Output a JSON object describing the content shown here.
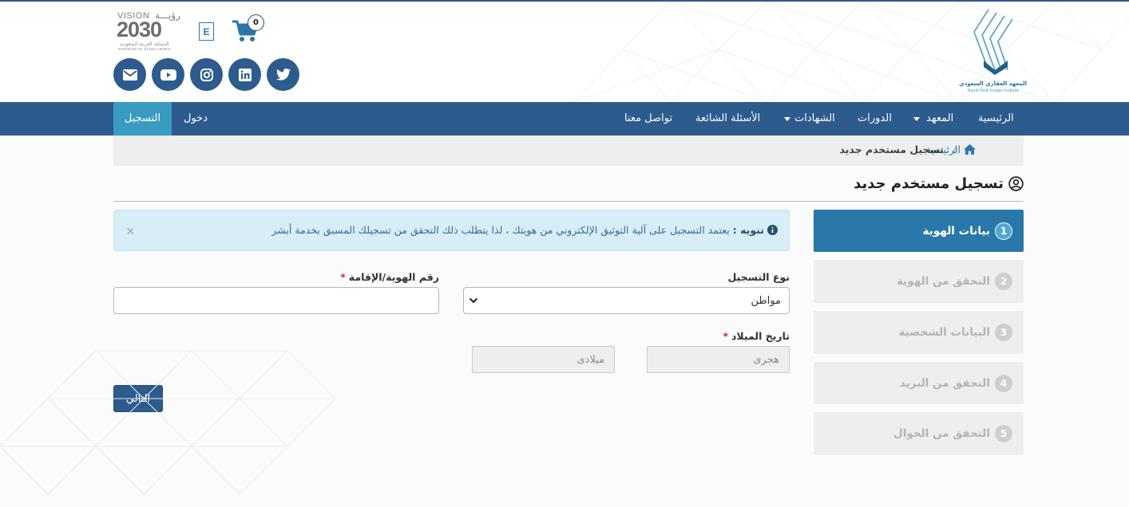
{
  "header": {
    "logo_text_ar": "المعهد العقاري السعودي",
    "logo_text_en": "Saudi Real Estate Institute",
    "vision_label": "VISION",
    "vision_label_ar": "رؤيـــة",
    "vision_year": "2030",
    "vision_sub_ar": "المملكة العربية السعودية",
    "vision_sub_en": "KINGDOM OF SAUDI ARABIA",
    "lang_toggle": "E",
    "cart_count": "0",
    "social_icons": [
      "envelope-icon",
      "youtube-icon",
      "instagram-icon",
      "linkedin-icon",
      "twitter-icon"
    ]
  },
  "nav": {
    "items": [
      {
        "label": "الرئيسية"
      },
      {
        "label": "المعهد",
        "dropdown": true
      },
      {
        "label": "الدورات"
      },
      {
        "label": "الشهادات",
        "dropdown": true
      },
      {
        "label": "الأسئلة الشائعة"
      },
      {
        "label": "تواصل معنا"
      }
    ],
    "login": "دخول",
    "register": "التسجيل"
  },
  "breadcrumb": {
    "home": "الرئيسية",
    "separator": "/",
    "current": "تسجيل مستخدم جديد"
  },
  "page": {
    "title": "تسجيل مستخدم جديد"
  },
  "steps": [
    {
      "number": "1",
      "label": "بيانات الهوية",
      "active": true
    },
    {
      "number": "2",
      "label": "التحقق من الهوية",
      "active": false
    },
    {
      "number": "3",
      "label": "البيانات الشخصية",
      "active": false
    },
    {
      "number": "4",
      "label": "التحقق من البريد",
      "active": false
    },
    {
      "number": "5",
      "label": "التحقق من الجوال",
      "active": false
    }
  ],
  "alert": {
    "title": "تنويه :",
    "message": "يعتمد التسجيل على آلية التوثيق الإلكتروني من هويتك ، لذا يتطلب ذلك التحقق من تسجيلك المسبق بخدمة أبشر",
    "close": "×"
  },
  "form": {
    "registration_type_label": "نوع التسجيل",
    "registration_type_value": "مواطن",
    "id_number_label": "رقم الهوية/الإقامة",
    "id_number_value": "",
    "required_mark": "*",
    "birth_date_label": "تاريخ الميلاد",
    "hijri_placeholder": "هجرى",
    "gregorian_placeholder": "ميلادى",
    "next_button": "التالي"
  },
  "colors": {
    "primary": "#2d5b8e",
    "accent": "#2978a9",
    "register_tab": "#3a9bc2",
    "alert_bg": "#d9edf7"
  }
}
